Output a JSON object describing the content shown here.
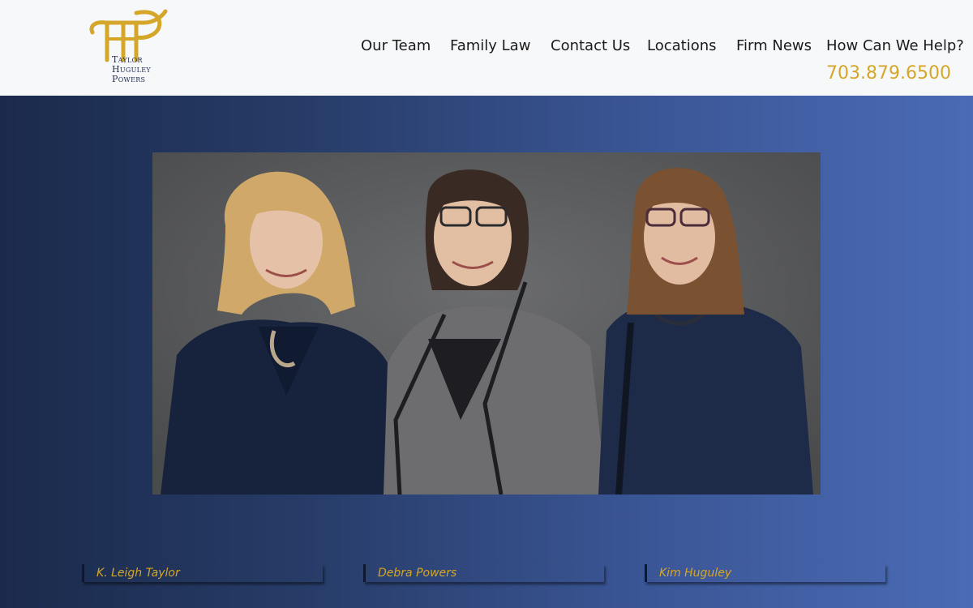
{
  "logo": {
    "monogram": "THP",
    "lines": [
      "Taylor",
      "Huguley",
      "Powers"
    ]
  },
  "nav": {
    "items": [
      {
        "label": "Our Team"
      },
      {
        "label": "Family Law"
      },
      {
        "label": "Contact Us"
      },
      {
        "label": "Locations"
      },
      {
        "label": "Firm News"
      },
      {
        "label": "How Can We Help?"
      }
    ],
    "phone": "703.879.6500"
  },
  "team": {
    "members": [
      {
        "name": "K. Leigh Taylor"
      },
      {
        "name": "Debra Powers"
      },
      {
        "name": "Kim Huguley"
      }
    ]
  },
  "colors": {
    "accent_gold": "#d4a62a",
    "navy_dark": "#1b2a4c",
    "blue_light": "#4a6bb5",
    "header_bg": "#f7f8fa"
  }
}
